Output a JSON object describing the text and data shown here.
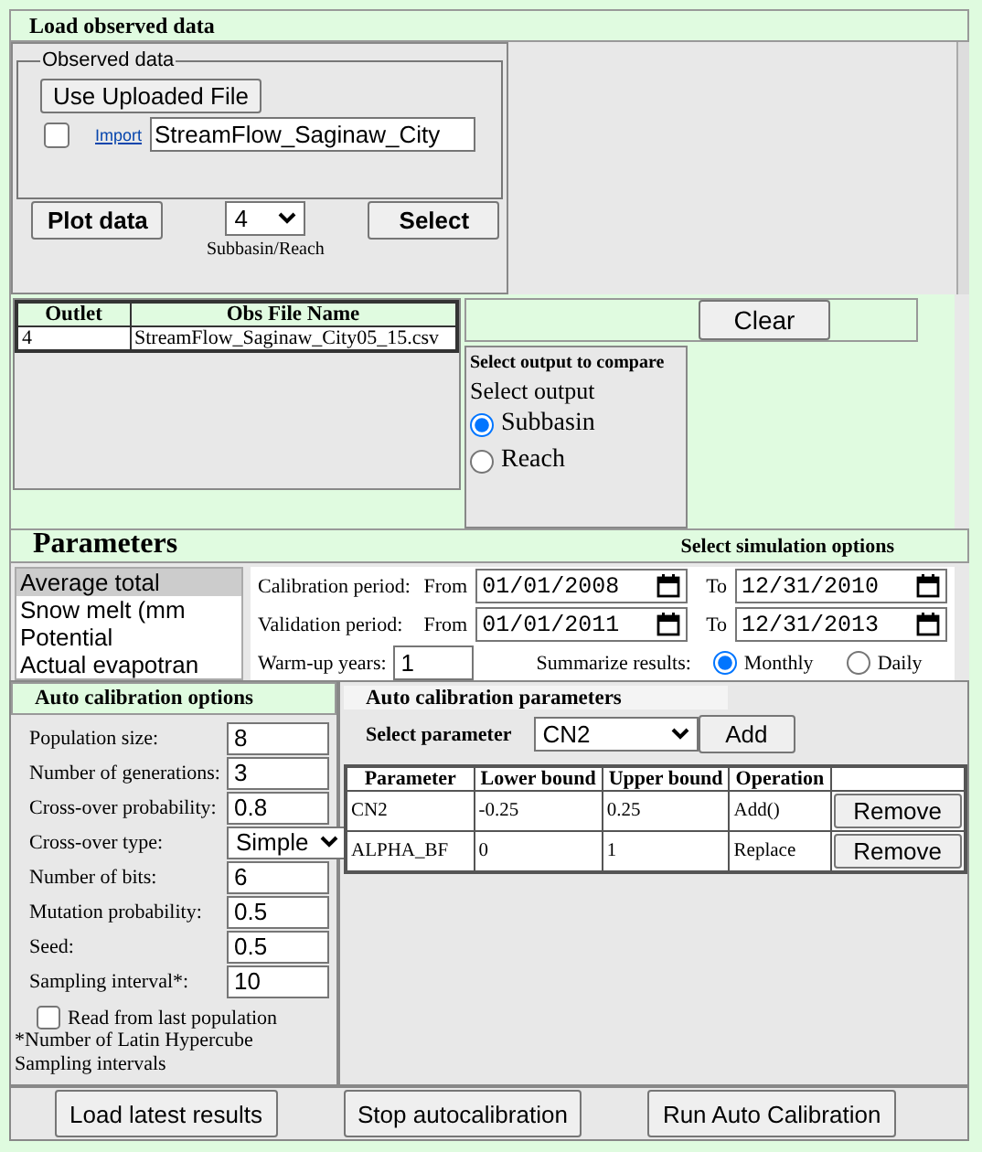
{
  "load_observed": {
    "title": "Load observed data",
    "legend": "Observed data",
    "use_file_button": "Use Uploaded File",
    "import_checkbox": {
      "checked": false
    },
    "import_link": "Import",
    "file_field": "StreamFlow_Saginaw_City",
    "plot_button": "Plot data",
    "outlet_select": "4",
    "outlet_select_label": "Subbasin/Reach",
    "select_button": "Select"
  },
  "outlets_table": {
    "columns": [
      "Outlet",
      "Obs File Name"
    ],
    "rows": [
      [
        "4",
        "StreamFlow_Saginaw_City05_15.csv"
      ]
    ]
  },
  "clear_button": "Clear",
  "output_compare": {
    "title": "Select output to compare",
    "legend": "Select output",
    "options": [
      {
        "label": "Subbasin",
        "selected": true
      },
      {
        "label": "Reach",
        "selected": false
      }
    ]
  },
  "parameters": {
    "title": "Parameters",
    "items": [
      {
        "label": "Average total",
        "selected": true
      },
      {
        "label": "Snow melt (mm",
        "selected": false
      },
      {
        "label": "Potential",
        "selected": false
      },
      {
        "label": "Actual evapotran",
        "selected": false
      }
    ]
  },
  "simulation_options": {
    "title": "Select simulation options",
    "periods": [
      {
        "label": "Calibration period:",
        "from_label": "From",
        "from": "01/01/2008",
        "to_label": "To",
        "to": "12/31/2010"
      },
      {
        "label": "Validation period:",
        "from_label": "From",
        "from": "01/01/2011",
        "to_label": "To",
        "to": "12/31/2013"
      }
    ],
    "warmup_label": "Warm-up years:",
    "warmup": "1",
    "summarize_label": "Summarize results:",
    "summarize": [
      {
        "label": "Monthly",
        "selected": true
      },
      {
        "label": "Daily",
        "selected": false
      }
    ]
  },
  "auto_calibration_options": {
    "title": "Auto calibration options",
    "fields": [
      {
        "label": "Population size:",
        "value": "8",
        "kind": "text"
      },
      {
        "label": "Number of generations:",
        "value": "3",
        "kind": "text"
      },
      {
        "label": "Cross-over probability:",
        "value": "0.8",
        "kind": "text"
      },
      {
        "label": "Cross-over type:",
        "value": "Simple",
        "kind": "select"
      },
      {
        "label": "Number of bits:",
        "value": "6",
        "kind": "text"
      },
      {
        "label": "Mutation probability:",
        "value": "0.5",
        "kind": "text"
      },
      {
        "label": "Seed:",
        "value": "0.5",
        "kind": "text"
      },
      {
        "label": "Sampling interval*:",
        "value": "10",
        "kind": "text"
      }
    ],
    "read_last": {
      "label": "Read from last population",
      "checked": false
    },
    "footnote": "*Number of Latin Hypercube Sampling intervals"
  },
  "auto_calibration_parameters": {
    "title": "Auto calibration parameters",
    "select_label": "Select parameter",
    "select_value": "CN2",
    "add_button": "Add",
    "columns": [
      "Parameter",
      "Lower bound",
      "Upper bound",
      "Operation"
    ],
    "rows": [
      {
        "cells": [
          "CN2",
          "-0.25",
          "0.25",
          "Add()"
        ],
        "button": "Remove"
      },
      {
        "cells": [
          "ALPHA_BF",
          "0",
          "1",
          "Replace"
        ],
        "button": "Remove"
      }
    ]
  },
  "actions": [
    "Load latest results",
    "Stop autocalibration",
    "Run Auto Calibration"
  ]
}
